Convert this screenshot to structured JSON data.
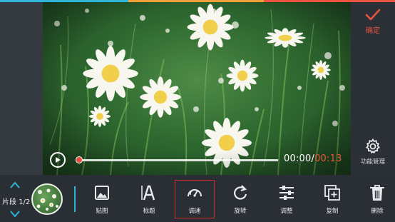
{
  "header": {
    "confirm_label": "确定",
    "function_manage_label": "功能管理"
  },
  "player": {
    "current_time": "00:00",
    "separator": "/",
    "total_time": "00:13",
    "progress": 0
  },
  "segment": {
    "label": "片段 1/2"
  },
  "toolbar": {
    "items": [
      {
        "label": "贴图",
        "icon": "sticker-icon"
      },
      {
        "label": "标题",
        "icon": "title-icon"
      },
      {
        "label": "调速",
        "icon": "speed-icon",
        "selected": true
      },
      {
        "label": "旋转",
        "icon": "rotate-icon"
      },
      {
        "label": "调整",
        "icon": "adjust-icon"
      },
      {
        "label": "复制",
        "icon": "copy-icon"
      },
      {
        "label": "删除",
        "icon": "delete-icon"
      }
    ]
  },
  "colors": {
    "accent": "#e8543f",
    "divider": "#2fb5d8",
    "selected_outline": "#d4262b",
    "top_strip": [
      "#2fb5d8",
      "#f2a13a",
      "#e8543f"
    ]
  }
}
